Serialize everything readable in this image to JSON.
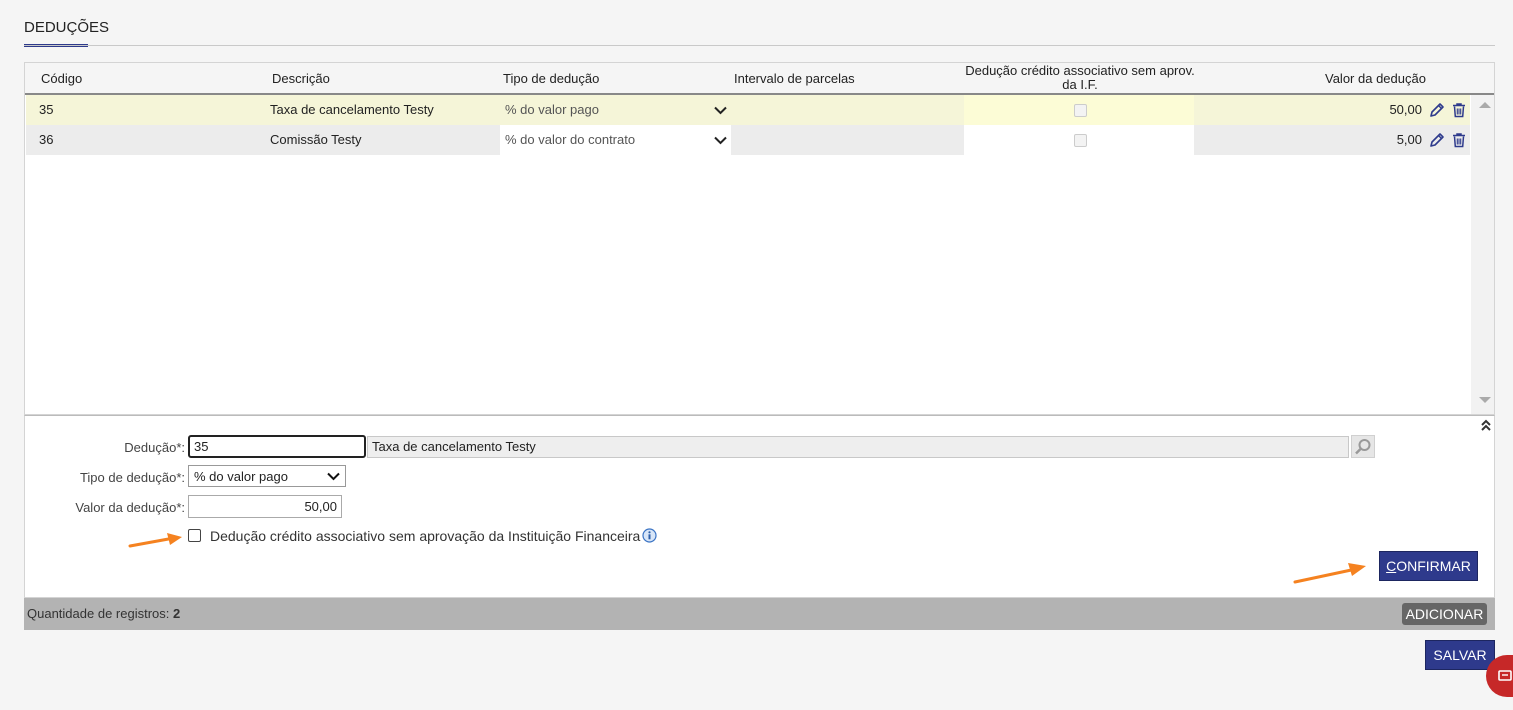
{
  "section": {
    "title": "DEDUÇÕES"
  },
  "table": {
    "columns": {
      "codigo": "Código",
      "descricao": "Descrição",
      "tipo": "Tipo de dedução",
      "intervalo": "Intervalo de parcelas",
      "credito_line1": "Dedução crédito associativo sem aprov.",
      "credito_line2": "da I.F.",
      "valor": "Valor da dedução"
    },
    "rows": [
      {
        "codigo": "35",
        "descricao": "Taxa de cancelamento Testy",
        "tipo": "% do valor pago",
        "intervalo": "",
        "credito": false,
        "valor": "50,00",
        "selected": true
      },
      {
        "codigo": "36",
        "descricao": "Comissão Testy",
        "tipo": "% do valor do contrato",
        "intervalo": "",
        "credito": false,
        "valor": "5,00",
        "selected": false
      }
    ]
  },
  "form": {
    "deducao_label": "Dedução*:",
    "deducao_code": "35",
    "deducao_desc": "Taxa de cancelamento Testy",
    "tipo_label": "Tipo de dedução*:",
    "tipo_value": "% do valor pago",
    "valor_label": "Valor da dedução*:",
    "valor_value": "50,00",
    "checkbox_label": "Dedução crédito associativo sem aprovação da Instituição Financeira",
    "confirm_underline": "C",
    "confirm_rest": "ONFIRMAR"
  },
  "footer": {
    "count_label": "Quantidade de registros:",
    "count_value": "2",
    "add_button": "ADICIONAR"
  },
  "save_button": "SALVAR",
  "colors": {
    "primary": "#2e3a8c",
    "selected_row": "#f5f5d8",
    "highlight_cell": "#fcfcd6",
    "annotation_arrow": "#f58220",
    "chat_button": "#c62828"
  }
}
